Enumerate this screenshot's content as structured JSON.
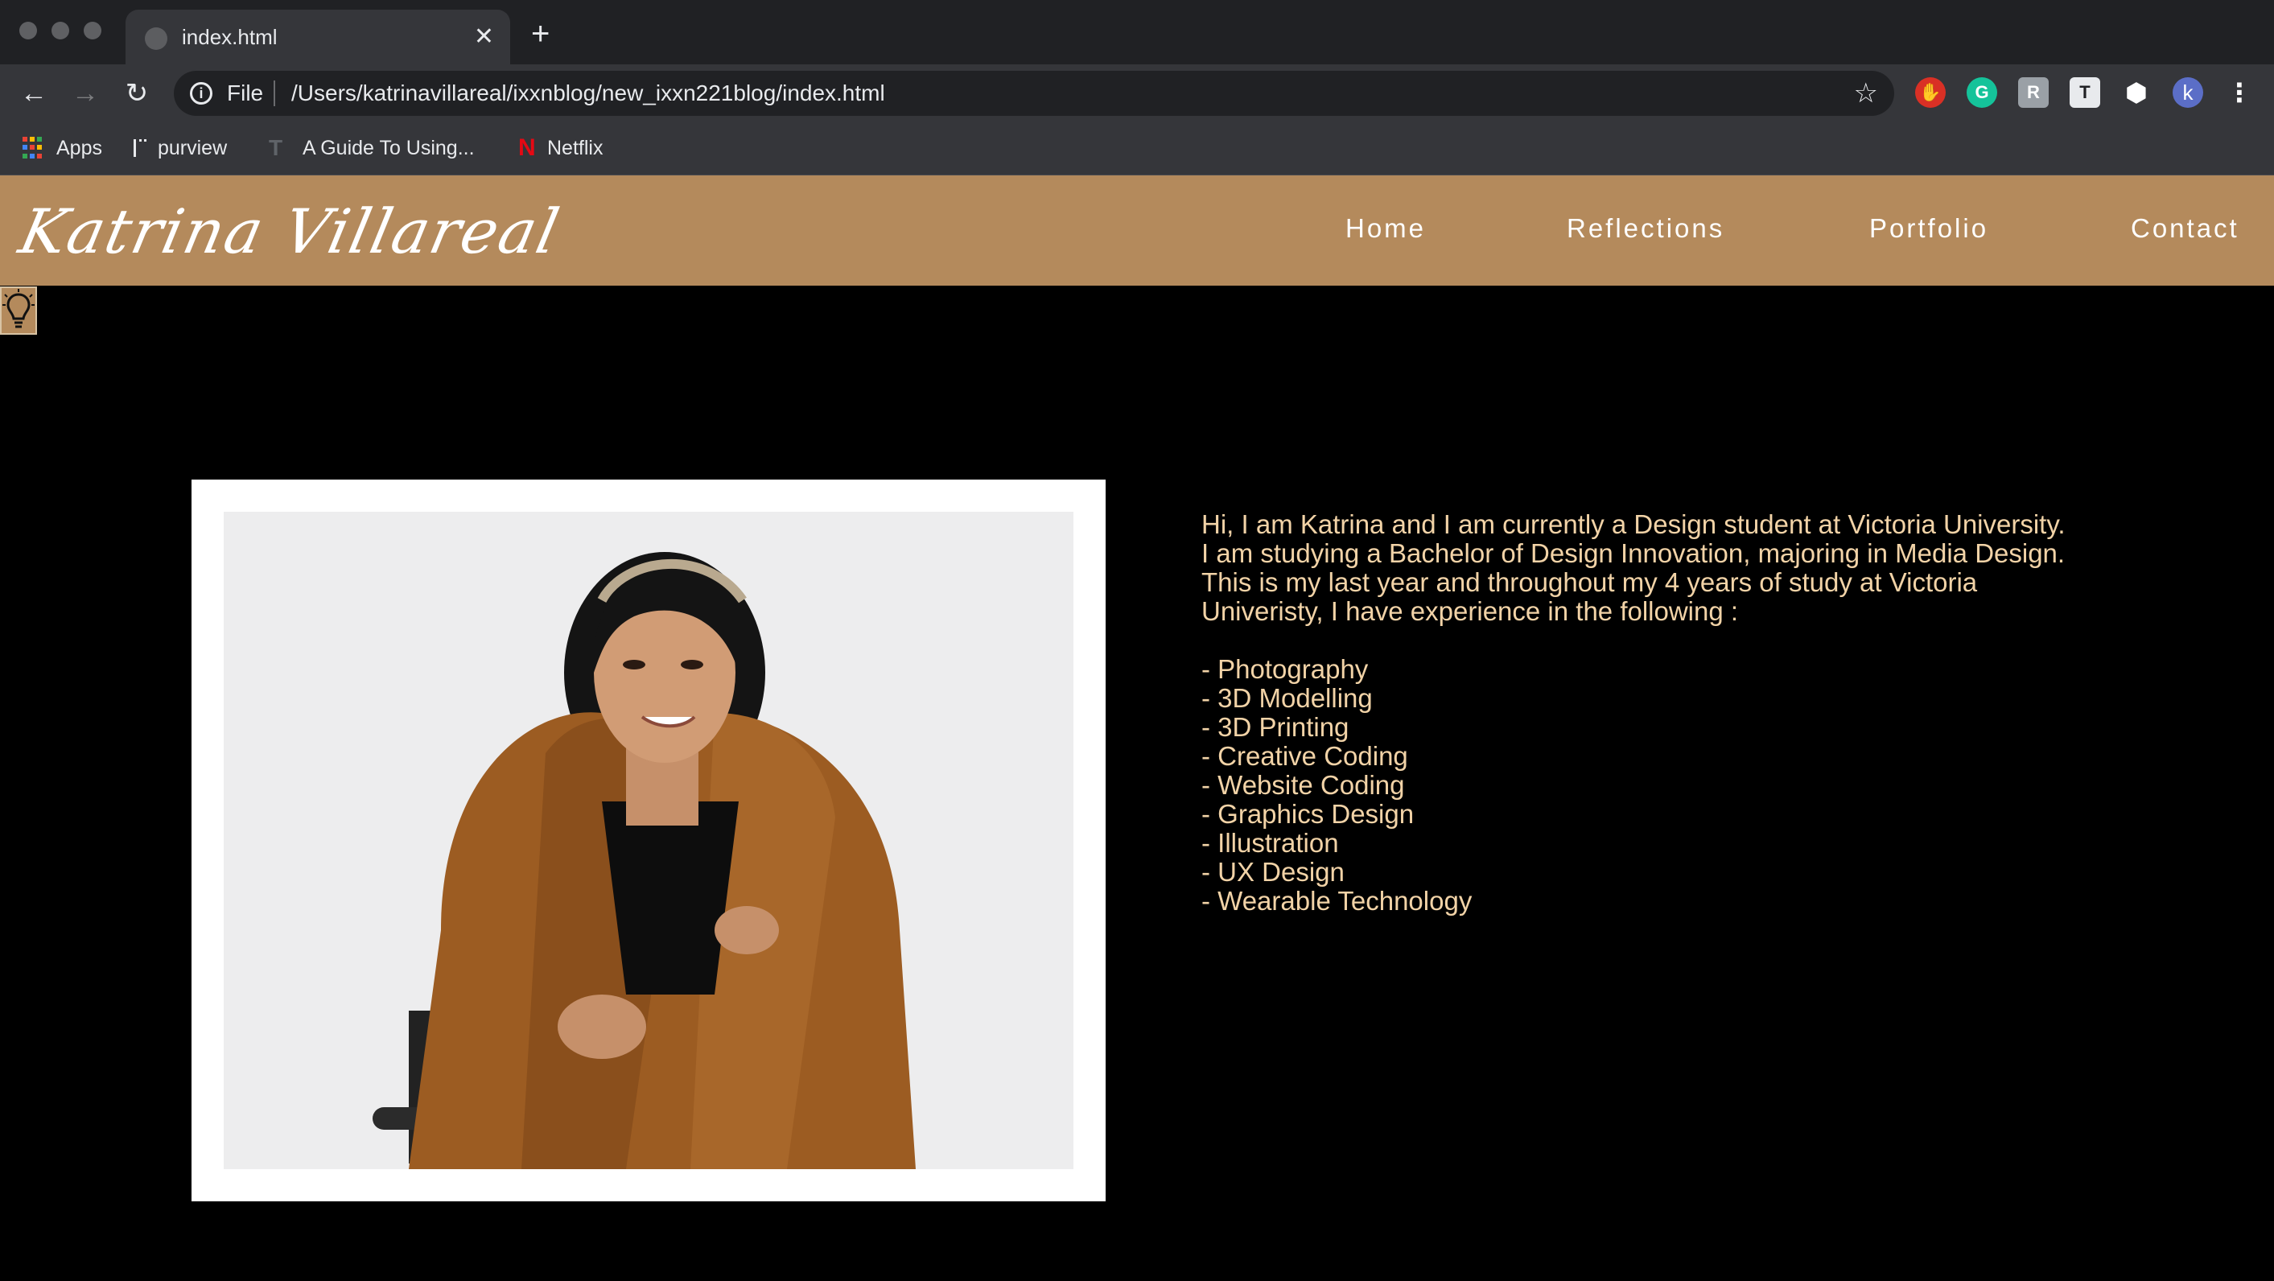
{
  "browser": {
    "tab_title": "index.html",
    "tab_close": "✕",
    "new_tab": "+",
    "omnibox_scheme": "File",
    "omnibox_url": "/Users/katrinavillareal/ixxnblog/new_ixxn221blog/index.html",
    "profile_initial": "k",
    "bookmarks": [
      {
        "label": "Apps"
      },
      {
        "label": "purview"
      },
      {
        "label": "A Guide To Using..."
      },
      {
        "label": "Netflix"
      }
    ]
  },
  "site": {
    "logo_text": "Katrina Villareal",
    "nav": [
      {
        "label": "Home"
      },
      {
        "label": "Reflections"
      },
      {
        "label": "Portfolio"
      },
      {
        "label": "Contact"
      }
    ],
    "bio": {
      "lines": [
        "Hi, I am Katrina and I am currently a Design student at Victoria University.",
        "I am studying a Bachelor of Design Innovation, majoring in Media Design.",
        "This is my last year and throughout my 4 years of study at Victoria",
        "Univeristy, I have experience in the following :"
      ],
      "skills": [
        "- Photography",
        "- 3D Modelling",
        "- 3D Printing",
        "- Creative Coding",
        "- Website Coding",
        "- Graphics Design",
        "- Illustration",
        "- UX Design",
        "- Wearable Technology"
      ]
    }
  },
  "colors": {
    "header_bg": "#b48a5c",
    "bio_text": "#f2d3a7",
    "page_bg": "#000000"
  }
}
